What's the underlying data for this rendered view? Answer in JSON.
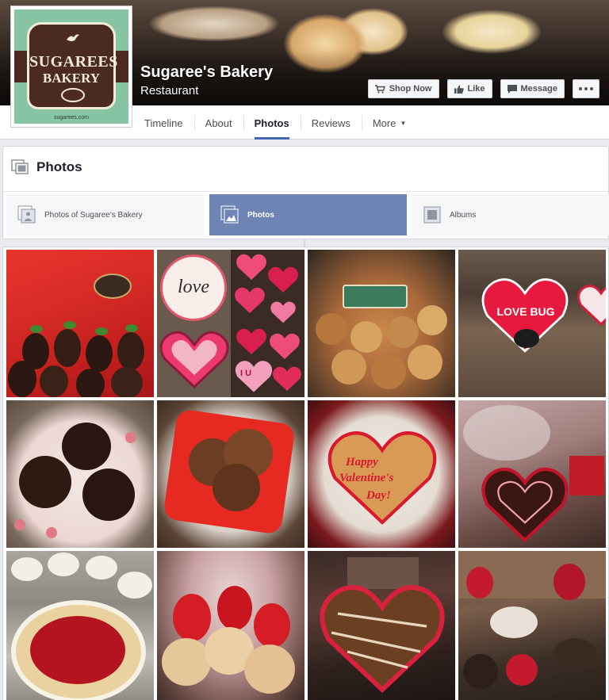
{
  "page": {
    "name": "Sugaree's Bakery",
    "category": "Restaurant",
    "logo": {
      "line1": "SUGAREES",
      "line2": "BAKERY",
      "site": "sugarees.com"
    }
  },
  "actions": [
    {
      "label": "Shop Now",
      "icon": "cart-icon"
    },
    {
      "label": "Like",
      "icon": "thumbs-up-icon"
    },
    {
      "label": "Message",
      "icon": "message-icon"
    },
    {
      "label": "",
      "icon": "more-icon"
    }
  ],
  "tabs": [
    {
      "label": "Timeline",
      "active": false
    },
    {
      "label": "About",
      "active": false
    },
    {
      "label": "Photos",
      "active": true
    },
    {
      "label": "Reviews",
      "active": false
    },
    {
      "label": "More",
      "active": false
    }
  ],
  "photos_panel": {
    "title": "Photos",
    "subtabs": [
      {
        "label": "Photos of Sugaree's Bakery",
        "active": false
      },
      {
        "label": "Photos",
        "active": true
      },
      {
        "label": "Albums",
        "active": false
      }
    ]
  },
  "photos": [
    {
      "subject": "chocolate-covered strawberries in red box"
    },
    {
      "subject": "love heart cookies collage"
    },
    {
      "subject": "cookie tray with bakery sticker"
    },
    {
      "subject": "love bug heart cookie"
    },
    {
      "subject": "chocolate dipped cupcakes"
    },
    {
      "subject": "coconut macaroons on red plate"
    },
    {
      "subject": "happy valentine's day cookie cake"
    },
    {
      "subject": "heart cake under plastic dome"
    },
    {
      "subject": "strawberry pie and cream tarts"
    },
    {
      "subject": "strawberry coconut tarts"
    },
    {
      "subject": "chocolate drizzled heart cake"
    },
    {
      "subject": "valentine display case"
    }
  ],
  "photo_text": {
    "love": "love",
    "love_bug": "LOVE BUG",
    "i_u": "I U",
    "happy": "Happy",
    "valentines": "Valentine's",
    "day": "Day!"
  },
  "colors": {
    "accent": "#4267b2",
    "subtab_active": "#6d84b4"
  }
}
